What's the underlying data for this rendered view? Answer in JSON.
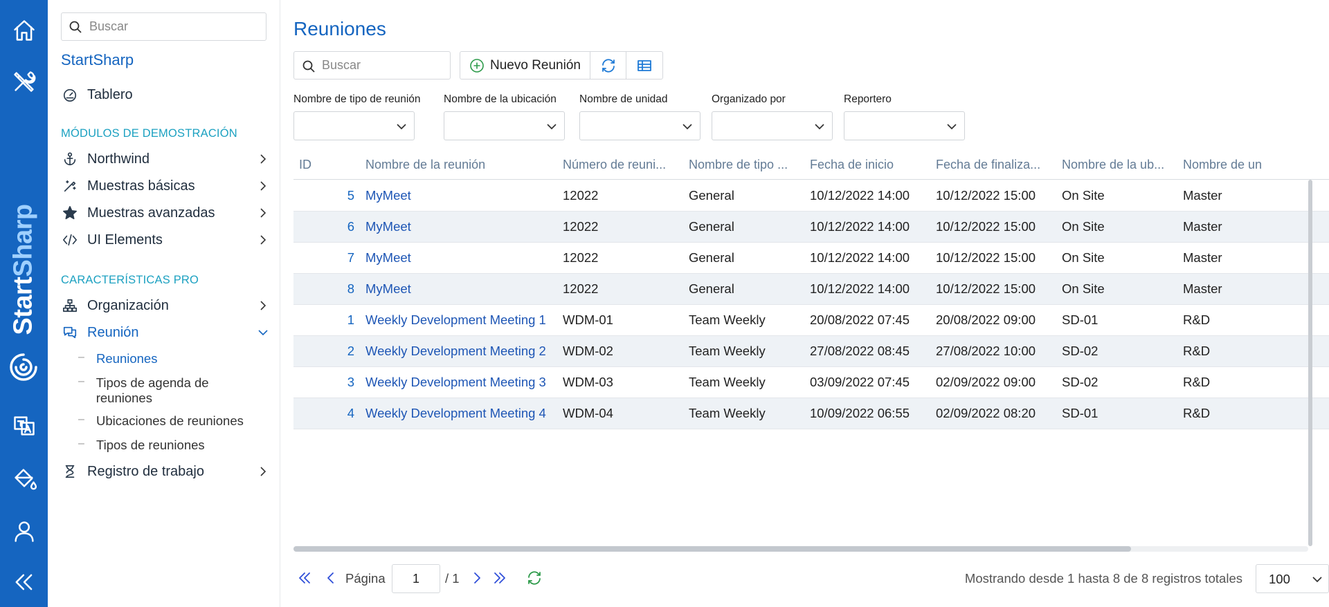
{
  "rail": {
    "brand_start": "Start",
    "brand_sharp": "Sharp"
  },
  "sidebar": {
    "search_placeholder": "Buscar",
    "brand": "StartSharp",
    "dashboard": "Tablero",
    "section_demo": "MÓDULOS DE DEMOSTRACIÓN",
    "demo_items": [
      "Northwind",
      "Muestras básicas",
      "Muestras avanzadas",
      "UI Elements"
    ],
    "section_pro": "CARACTERÍSTICAS PRO",
    "pro_items": [
      "Organización",
      "Reunión"
    ],
    "meeting_subitems": [
      "Reuniones",
      "Tipos de agenda de reuniones",
      "Ubicaciones de reuniones",
      "Tipos de reuniones"
    ],
    "worklog": "Registro de trabajo"
  },
  "main": {
    "title": "Reuniones",
    "search_placeholder": "Buscar",
    "new_button": "Nuevo Reunión",
    "filters": [
      "Nombre de tipo de reunión",
      "Nombre de la ubicación",
      "Nombre de unidad",
      "Organizado por",
      "Reportero"
    ]
  },
  "grid": {
    "columns": [
      "ID",
      "Nombre de la reunión",
      "Número de reuni...",
      "Nombre de tipo ...",
      "Fecha de inicio",
      "Fecha de finaliza...",
      "Nombre de la ub...",
      "Nombre de un"
    ],
    "rows": [
      [
        "5",
        "MyMeet",
        "12022",
        "General",
        "10/12/2022 14:00",
        "10/12/2022 15:00",
        "On Site",
        "Master"
      ],
      [
        "6",
        "MyMeet",
        "12022",
        "General",
        "10/12/2022 14:00",
        "10/12/2022 15:00",
        "On Site",
        "Master"
      ],
      [
        "7",
        "MyMeet",
        "12022",
        "General",
        "10/12/2022 14:00",
        "10/12/2022 15:00",
        "On Site",
        "Master"
      ],
      [
        "8",
        "MyMeet",
        "12022",
        "General",
        "10/12/2022 14:00",
        "10/12/2022 15:00",
        "On Site",
        "Master"
      ],
      [
        "1",
        "Weekly Development Meeting 1",
        "WDM-01",
        "Team Weekly",
        "20/08/2022 07:45",
        "20/08/2022 09:00",
        "SD-01",
        "R&D"
      ],
      [
        "2",
        "Weekly Development Meeting 2",
        "WDM-02",
        "Team Weekly",
        "27/08/2022 08:45",
        "27/08/2022 10:00",
        "SD-02",
        "R&D"
      ],
      [
        "3",
        "Weekly Development Meeting 3",
        "WDM-03",
        "Team Weekly",
        "03/09/2022 07:45",
        "02/09/2022 09:00",
        "SD-02",
        "R&D"
      ],
      [
        "4",
        "Weekly Development Meeting 4",
        "WDM-04",
        "Team Weekly",
        "10/09/2022 06:55",
        "02/09/2022 08:20",
        "SD-01",
        "R&D"
      ]
    ]
  },
  "pager": {
    "page_label": "Página",
    "page_value": "1",
    "page_of": "/ 1",
    "info": "Mostrando desde 1 hasta 8 de 8 registros totales",
    "page_size": "100"
  },
  "colors": {
    "rail": "#1565c0",
    "accent": "#1565c0",
    "section": "#1ca1c1",
    "row_alt": "#eef2f6",
    "header_text": "#637b95"
  },
  "icons": {
    "rail": [
      "home-icon",
      "tools-icon",
      "translate-icon",
      "paint-bucket-icon",
      "user-icon",
      "collapse-icon"
    ],
    "sidebar": [
      "search-icon",
      "dashboard-icon",
      "anchor-icon",
      "magic-wand-icon",
      "star-icon",
      "code-icon",
      "sitemap-icon",
      "chat-icon",
      "hourglass-icon"
    ]
  }
}
